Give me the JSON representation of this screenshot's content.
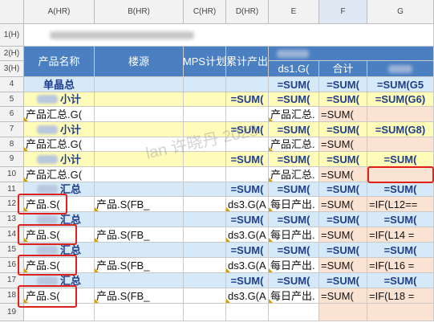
{
  "col_headers": [
    "A(HR)",
    "B(HR)",
    "C(HR)",
    "D(HR)",
    "E",
    "F",
    "G"
  ],
  "row_headers": [
    "1(H)",
    "2(H)",
    "3(H)",
    "4",
    "5",
    "6",
    "7",
    "8",
    "9",
    "10",
    "11",
    "12",
    "13",
    "14",
    "15",
    "16",
    "17",
    "18",
    "19"
  ],
  "header_row": {
    "product_name": "产品名称",
    "building_source": "楼源",
    "mps_plan": "MPS计划",
    "cumulative_output": "累计产出",
    "e_title": "ds1.G(",
    "f_title": "合计"
  },
  "rows": {
    "r4": {
      "a": "单晶总",
      "e": "=SUM(",
      "f": "=SUM(",
      "g": "=SUM(G5"
    },
    "r5": {
      "a": "小计",
      "d": "=SUM(",
      "e": "=SUM(",
      "f": "=SUM(",
      "g": "=SUM(G6)"
    },
    "r6": {
      "a": "产品汇总.G(",
      "e": "产品汇总.",
      "f": "=SUM("
    },
    "r7": {
      "a": "小计",
      "d": "=SUM(",
      "e": "=SUM(",
      "f": "=SUM(",
      "g": "=SUM(G8)"
    },
    "r8": {
      "a": "产品汇总.G(",
      "e": "产品汇总.",
      "f": "=SUM("
    },
    "r9": {
      "a": "小计",
      "d": "=SUM(",
      "e": "=SUM(",
      "f": "=SUM(",
      "g": "=SUM("
    },
    "r10": {
      "a": "产品汇总.G(",
      "e": "产品汇总.",
      "f": "=SUM("
    },
    "r11": {
      "a": "汇总",
      "d": "=SUM(",
      "e": "=SUM(",
      "f": "=SUM(",
      "g": "=SUM("
    },
    "r12": {
      "a": "产品.S(",
      "b": "产品.S(FB_",
      "d": "ds3.G(A",
      "e": "每日产出.",
      "f": "=SUM(",
      "g": "=IF(L12=="
    },
    "r13": {
      "a": "汇总",
      "d": "=SUM(",
      "e": "=SUM(",
      "f": "=SUM(",
      "g": "=SUM("
    },
    "r14": {
      "a": "产品.S(",
      "b": "产品.S(FB_",
      "d": "ds3.G(A",
      "e": "每日产出.",
      "f": "=SUM(",
      "g": "=IF(L14 ="
    },
    "r15": {
      "a": "汇总",
      "d": "=SUM(",
      "e": "=SUM(",
      "f": "=SUM(",
      "g": "=SUM("
    },
    "r16": {
      "a": "产品.S(",
      "b": "产品.S(FB_",
      "d": "ds3.G(A",
      "e": "每日产出.",
      "f": "=SUM(",
      "g": "=IF(L16 ="
    },
    "r17": {
      "a": "汇总",
      "d": "=SUM(",
      "e": "=SUM(",
      "f": "=SUM(",
      "g": "=SUM("
    },
    "r18": {
      "a": "产品.S(",
      "b": "产品.S(FB_",
      "d": "ds3.G(A",
      "e": "每日产出.",
      "f": "=SUM(",
      "g": "=IF(L18 ="
    }
  },
  "watermark": "lan 许晓丹 2023",
  "colors": {
    "header_blue": "#4a7fc1",
    "light_blue": "#d6e9f8",
    "yellow": "#fffbb8",
    "pink": "#fbe3d4",
    "highlight_red": "#e0201a"
  }
}
